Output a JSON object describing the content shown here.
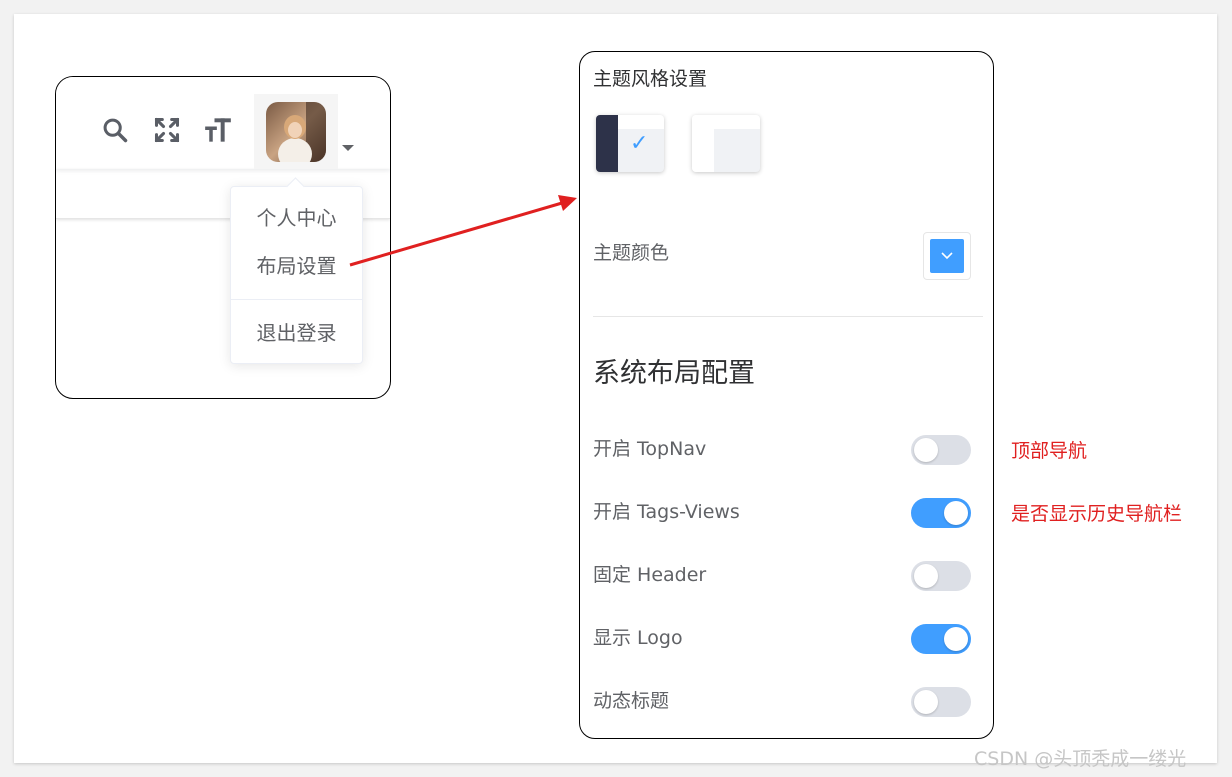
{
  "dropdown": {
    "items": [
      {
        "label": "个人中心"
      },
      {
        "label": "布局设置"
      },
      {
        "label": "退出登录"
      }
    ]
  },
  "settings": {
    "title": "主题风格设置",
    "theme_color_label": "主题颜色",
    "theme_color": "#409eff",
    "section_title": "系统布局配置",
    "toggles": [
      {
        "label": "开启 TopNav",
        "on": false
      },
      {
        "label": "开启 Tags-Views",
        "on": true
      },
      {
        "label": "固定 Header",
        "on": false
      },
      {
        "label": "显示 Logo",
        "on": true
      },
      {
        "label": "动态标题",
        "on": false
      }
    ]
  },
  "annotations": {
    "topnav": "顶部导航",
    "tags_views": "是否显示历史导航栏"
  },
  "watermark": "CSDN @头顶秃成一缕光",
  "colors": {
    "accent": "#409eff",
    "dark_sidebar": "#304156",
    "switch_off": "#dcdfe6",
    "arrow": "#e02020"
  }
}
